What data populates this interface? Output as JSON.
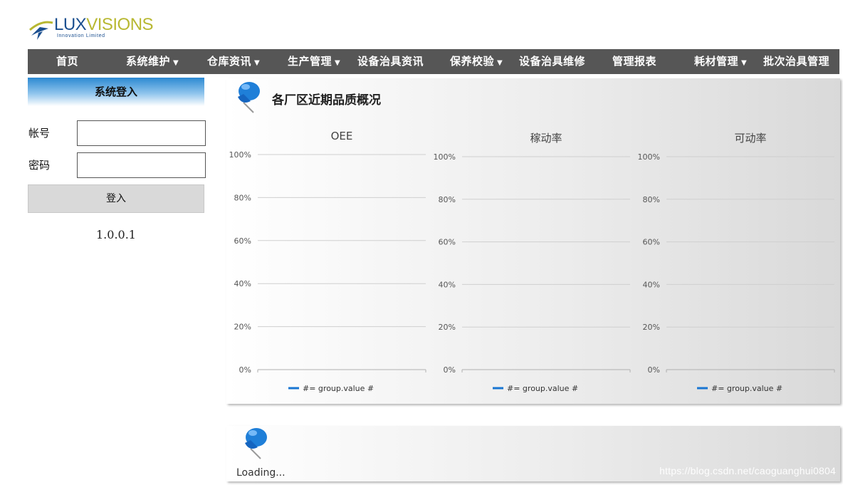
{
  "logo": {
    "brand_part1": "LUX",
    "brand_part2": "VISIONS",
    "tagline": "Innovation Limited"
  },
  "nav": {
    "items": [
      {
        "label": "首页",
        "dropdown": false
      },
      {
        "label": "系统维护",
        "dropdown": true
      },
      {
        "label": "仓库资讯",
        "dropdown": true
      },
      {
        "label": "生产管理",
        "dropdown": true
      },
      {
        "label": "设备治具资讯",
        "dropdown": false
      },
      {
        "label": "保养校验",
        "dropdown": true
      },
      {
        "label": "设备治具维修",
        "dropdown": false
      },
      {
        "label": "管理报表",
        "dropdown": false
      },
      {
        "label": "耗材管理",
        "dropdown": true
      },
      {
        "label": "批次治具管理",
        "dropdown": false
      }
    ],
    "caret": "▼"
  },
  "login": {
    "title": "系统登入",
    "account_label": "帐号",
    "account_value": "",
    "password_label": "密码",
    "password_value": "",
    "submit_label": "登入",
    "version": "1.0.0.1"
  },
  "panel1": {
    "title": "各厂区近期品质概况"
  },
  "panel2": {
    "loading": "Loading..."
  },
  "watermark": "https://blog.csdn.net/caoguanghui0804",
  "colors": {
    "nav_bg": "#565656",
    "legend_line": "#1976d2",
    "header_blue": "#2b89d2"
  },
  "icons": {
    "pin": "pushpin-icon"
  },
  "chart_data": [
    {
      "type": "line",
      "title": "OEE",
      "y_ticks": [
        "100%",
        "80%",
        "60%",
        "40%",
        "20%",
        "0%"
      ],
      "ylim": [
        0,
        100
      ],
      "series": [
        {
          "name": "#= group.value #",
          "values": []
        }
      ],
      "legend_position": "bottom",
      "grid": true
    },
    {
      "type": "line",
      "title": "稼动率",
      "y_ticks": [
        "100%",
        "80%",
        "60%",
        "40%",
        "20%",
        "0%"
      ],
      "ylim": [
        0,
        100
      ],
      "series": [
        {
          "name": "#= group.value #",
          "values": []
        }
      ],
      "legend_position": "bottom",
      "grid": true
    },
    {
      "type": "line",
      "title": "可动率",
      "y_ticks": [
        "100%",
        "80%",
        "60%",
        "40%",
        "20%",
        "0%"
      ],
      "ylim": [
        0,
        100
      ],
      "series": [
        {
          "name": "#= group.value #",
          "values": []
        }
      ],
      "legend_position": "bottom",
      "grid": true
    }
  ]
}
